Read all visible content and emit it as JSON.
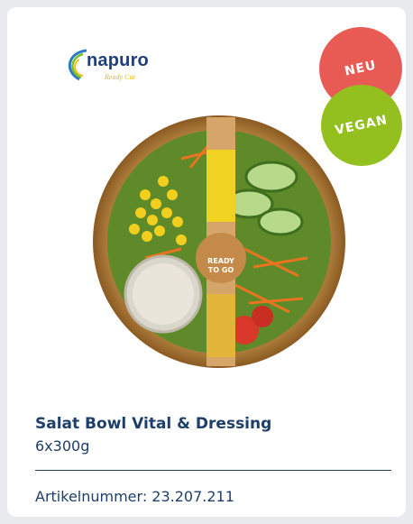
{
  "brand": {
    "name": "napuro",
    "tagline": "Ready Cut"
  },
  "badges": {
    "new": "NEU",
    "vegan": "VEGAN"
  },
  "product": {
    "title": "Salat Bowl Vital & Dressing",
    "pack_size": "6x300g",
    "article_number": "Artikelnummer: 23.207.211",
    "label_text_1": "READY",
    "label_text_2": "TO GO"
  },
  "colors": {
    "navy": "#1e3f6a",
    "badge_new": "#e85b55",
    "badge_vegan": "#93c01f"
  }
}
